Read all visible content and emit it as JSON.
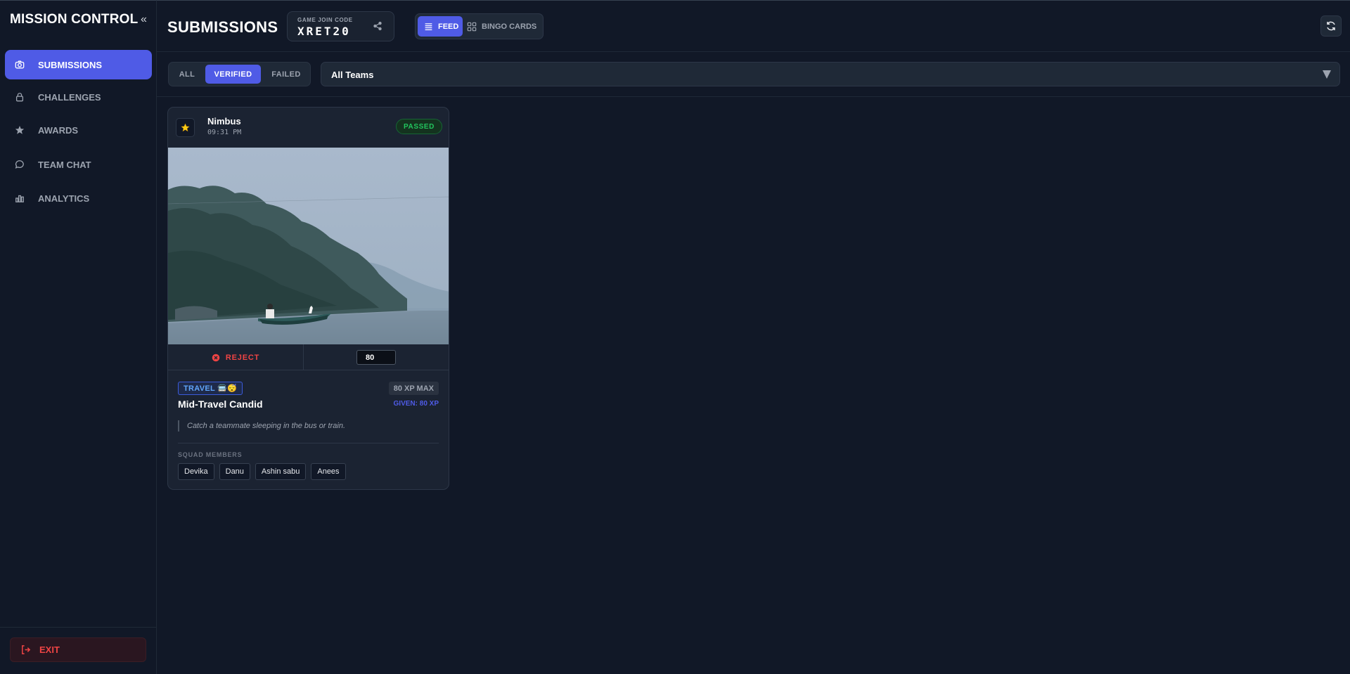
{
  "sidebar": {
    "brand": "MISSION CONTROL",
    "collapse_icon": "«",
    "items": [
      {
        "label": "SUBMISSIONS",
        "icon": "camera-icon",
        "active": true
      },
      {
        "label": "CHALLENGES",
        "icon": "lock-icon",
        "active": false
      },
      {
        "label": "AWARDS",
        "icon": "star-icon",
        "active": false
      },
      {
        "label": "TEAM CHAT",
        "icon": "chat-icon",
        "active": false
      },
      {
        "label": "ANALYTICS",
        "icon": "bar-chart-icon",
        "active": false
      }
    ],
    "exit_label": "EXIT"
  },
  "header": {
    "title": "SUBMISSIONS",
    "join_label": "GAME JOIN CODE",
    "join_code": "XRET20",
    "view_feed": "FEED",
    "view_bingo": "BINGO CARDS"
  },
  "filters": {
    "tabs": [
      "ALL",
      "VERIFIED",
      "FAILED"
    ],
    "active_tab": "VERIFIED",
    "team_select": "All Teams"
  },
  "card": {
    "team": "Nimbus",
    "time": "09:31 PM",
    "status": "PASSED",
    "reject_label": "REJECT",
    "xp_value": "80",
    "category": "TRAVEL 🚍😴",
    "xp_max": "80 XP MAX",
    "xp_given": "GIVEN: 80 XP",
    "title": "Mid-Travel Candid",
    "description": "Catch a teammate sleeping in the bus or train.",
    "squad_label": "SQUAD MEMBERS",
    "members": [
      "Devika",
      "Danu",
      "Ashin sabu",
      "Anees"
    ]
  },
  "colors": {
    "background": "#111827",
    "accent": "#4f5be6",
    "danger": "#ef4444",
    "success": "#22c55e"
  }
}
